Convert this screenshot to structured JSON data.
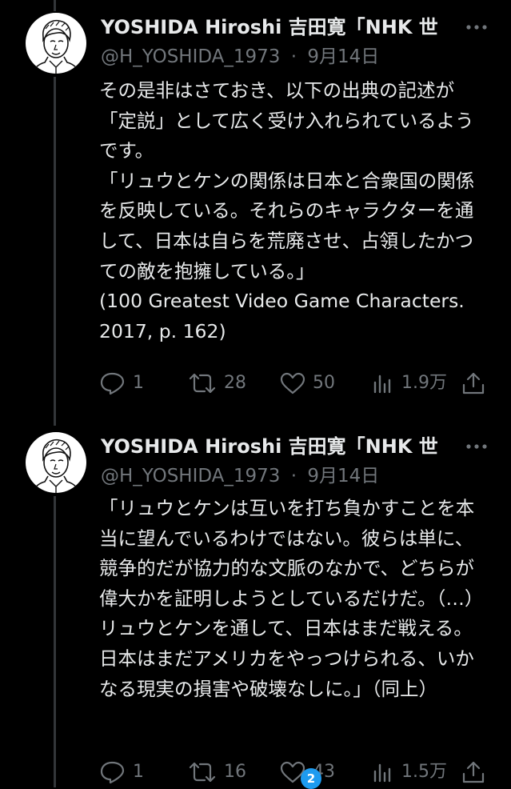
{
  "colors": {
    "background": "#000000",
    "text_primary": "#e7e9ea",
    "text_secondary": "#71767b",
    "thread_line": "#333639",
    "badge": "#1d9bf0"
  },
  "tweets": [
    {
      "author_name": "YOSHIDA Hiroshi 吉田寛「NHK 世",
      "handle": "@H_YOSHIDA_1973",
      "separator": "·",
      "date": "9月14日",
      "text": "その是非はさておき、以下の出典の記述が「定説」として広く受け入れられているようです。\n「リュウとケンの関係は日本と合衆国の関係を反映している。それらのキャラクターを通して、日本は自らを荒廃させ、占領したかつての敵を抱擁している。」\n(100 Greatest Video Game Characters. 2017, p. 162)",
      "replies": "1",
      "retweets": "28",
      "likes": "50",
      "views": "1.9万",
      "icons": {
        "reply": "reply-icon",
        "retweet": "retweet-icon",
        "like": "heart-icon",
        "views": "views-chart-icon",
        "share": "share-icon",
        "more": "more-options-icon"
      }
    },
    {
      "author_name": "YOSHIDA Hiroshi 吉田寛「NHK 世",
      "handle": "@H_YOSHIDA_1973",
      "separator": "·",
      "date": "9月14日",
      "text": "「リュウとケンは互いを打ち負かすことを本当に望んでいるわけではない。彼らは単に、競争的だが協力的な文脈のなかで、どちらが偉大かを証明しようとしているだけだ。（…）リュウとケンを通して、日本はまだ戦える。日本はまだアメリカをやっつけられる、いかなる現実の損害や破壊なしに。」（同上）",
      "replies": "1",
      "retweets": "16",
      "likes": "43",
      "views": "1.5万",
      "icons": {
        "reply": "reply-icon",
        "retweet": "retweet-icon",
        "like": "heart-icon",
        "views": "views-chart-icon",
        "share": "share-icon",
        "more": "more-options-icon"
      }
    }
  ],
  "notification_badge": "2"
}
